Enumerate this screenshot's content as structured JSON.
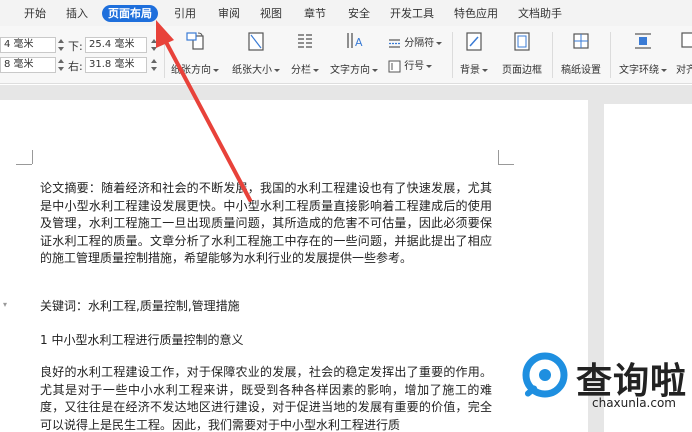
{
  "tabs": [
    "开始",
    "插入",
    "页面布局",
    "引用",
    "审阅",
    "视图",
    "章节",
    "安全",
    "开发工具",
    "特色应用",
    "文档助手"
  ],
  "active_tab": "页面布局",
  "margins": {
    "top_value": "4 毫米",
    "bottom_label": "下:",
    "bottom_value": "25.4 毫米",
    "left_value": "8 毫米",
    "right_label": "右:",
    "right_value": "31.8 毫米"
  },
  "ribbon": {
    "orientation": "纸张方向",
    "size": "纸张大小",
    "columns": "分栏",
    "text_direction": "文字方向",
    "separator": "分隔符",
    "line_numbers": "行号",
    "background": "背景",
    "page_border": "页面边框",
    "grid_setup": "稿纸设置",
    "text_wrap": "文字环绕",
    "align": "对齐"
  },
  "document": {
    "abstract": "论文摘要：随着经济和社会的不断发展，我国的水利工程建设也有了快速发展，尤其是中小型水利工程建设发展更快。中小型水利工程质量直接影响着工程建成后的使用及管理，水利工程施工一旦出现质量问题，其所造成的危害不可估量，因此必须要保证水利工程的质量。文章分析了水利工程施工中存在的一些问题，并据此提出了相应的施工管理质量控制措施，希望能够为水利行业的发展提供一些参考。",
    "keywords": "关键词：水利工程,质量控制,管理措施",
    "heading1": "1 中小型水利工程进行质量控制的意义",
    "body1": "良好的水利工程建设工作，对于保障农业的发展，社会的稳定发挥出了重要的作用。尤其是对于一些中小水利工程来讲，既受到各种各样因素的影响，增加了施工的难度，又往往是在经济不发达地区进行建设，对于促进当地的发展有重要的价值，完全可以说得上是民生工程。因此，我们需要对于中小型水利工程进行质"
  },
  "watermark": {
    "brand": "查询啦",
    "url": "chaxunla.com"
  },
  "colors": {
    "active_tab": "#1e6fdc",
    "arrow": "#e8423a",
    "watermark_blue": "#1e8fe0"
  }
}
